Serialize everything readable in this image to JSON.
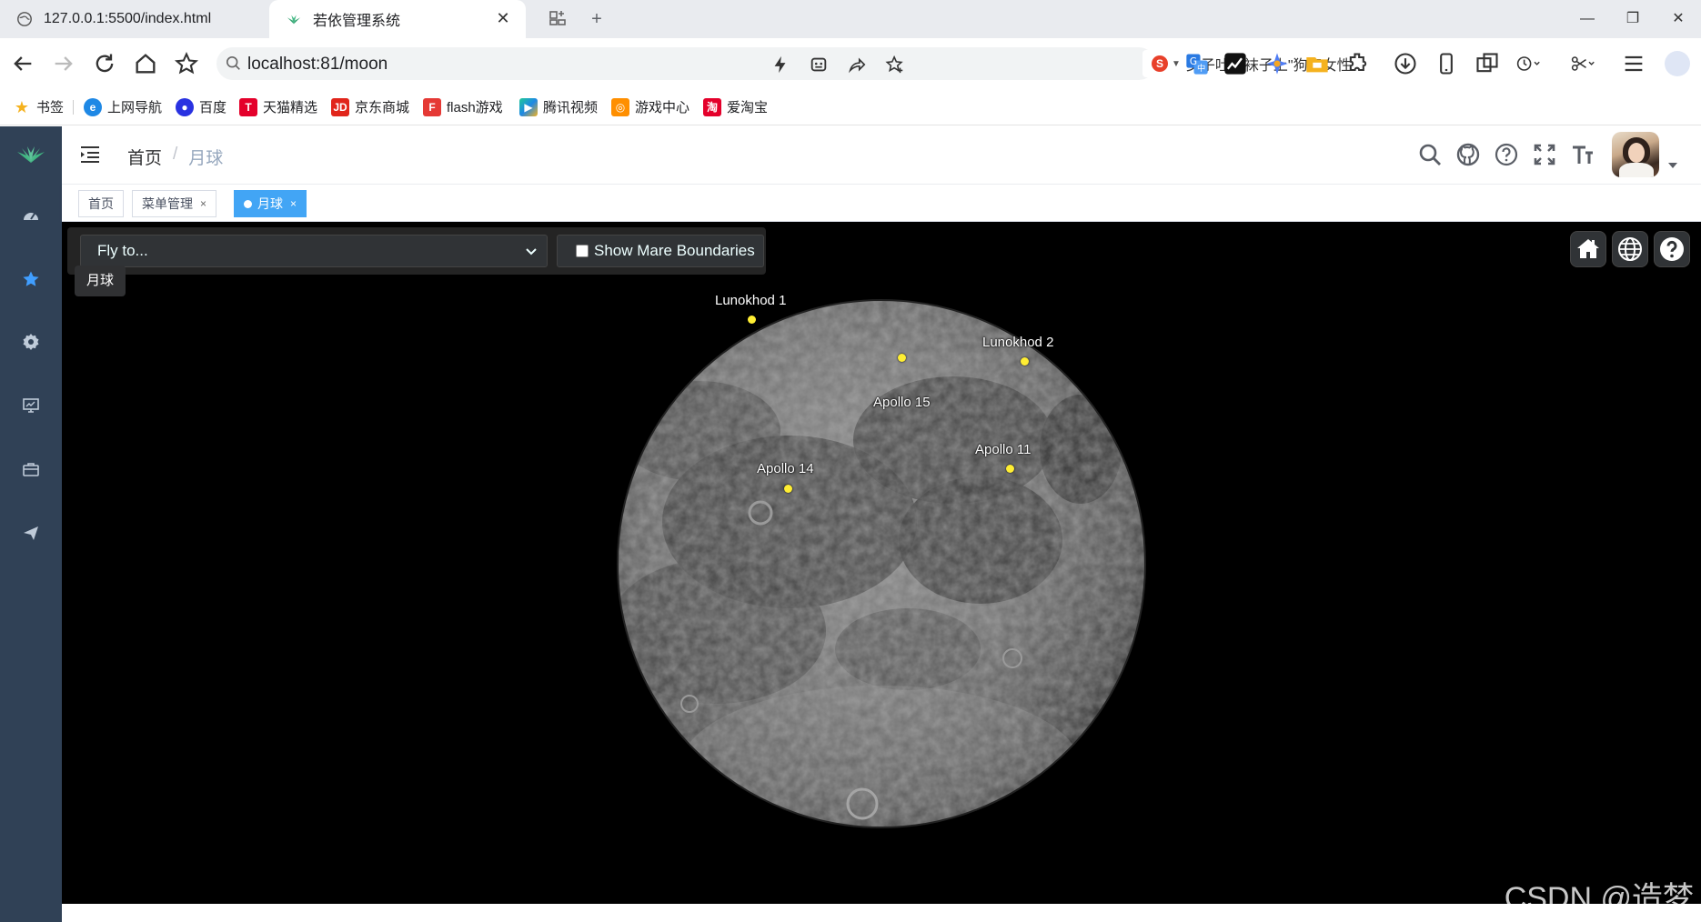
{
  "browser": {
    "tabs": [
      {
        "title": "127.0.0.1:5500/index.html"
      },
      {
        "title": "若依管理系统"
      }
    ],
    "url": "localhost:81/moon",
    "search_suggestion": "女子吐槽袜子上\"狗牵女性",
    "bookmarks": [
      "书签",
      "上网导航",
      "百度",
      "天猫精选",
      "京东商城",
      "flash游戏",
      "腾讯视频",
      "游戏中心",
      "爱淘宝"
    ]
  },
  "app": {
    "breadcrumb": {
      "home": "首页",
      "sep": "/",
      "current": "月球"
    },
    "tags": [
      {
        "label": "首页"
      },
      {
        "label": "菜单管理",
        "close": "×"
      },
      {
        "label": "月球",
        "close": "×"
      }
    ]
  },
  "viewer": {
    "fly_to_placeholder": "Fly to...",
    "mare_button_label": "Show Mare Boundaries",
    "tooltip": "月球",
    "markers": [
      {
        "name": "Lunokhod 1"
      },
      {
        "name": "Apollo 15"
      },
      {
        "name": "Lunokhod 2"
      },
      {
        "name": "Apollo 11"
      },
      {
        "name": "Apollo 14"
      }
    ],
    "watermark": "CSDN @造梦"
  },
  "colors": {
    "sidebar": "#304156",
    "tag_active": "#42a5f5",
    "marker": "#ffee33",
    "cesium_button": "#303336"
  }
}
